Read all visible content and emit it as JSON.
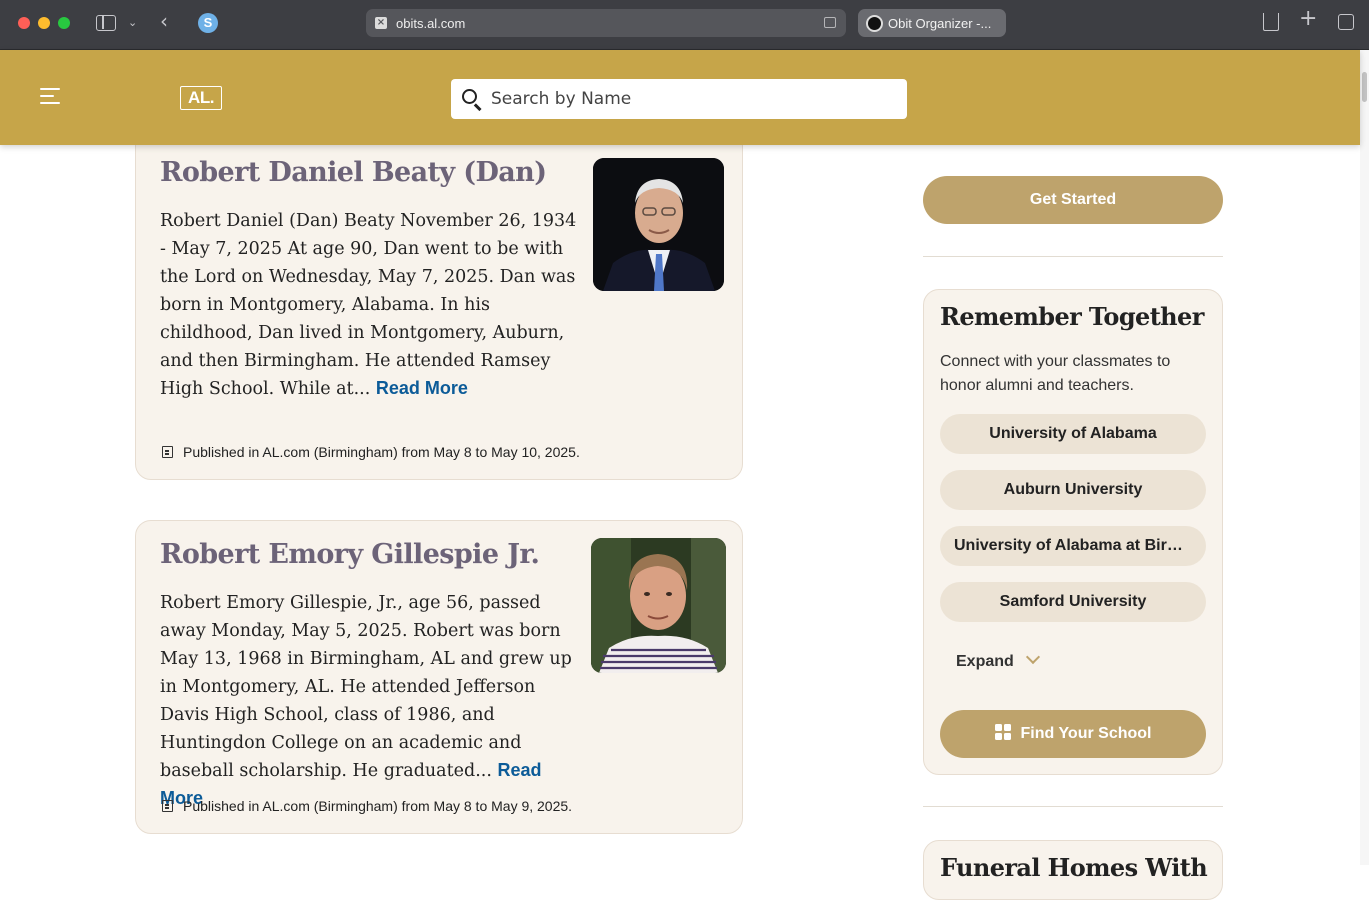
{
  "browser": {
    "url": "obits.al.com",
    "tab_title": "Obit Organizer -...",
    "extension_letter": "S"
  },
  "header": {
    "logo_text": "AL.",
    "search_placeholder": "Search by Name",
    "background_color": "#c6a549"
  },
  "obituaries": [
    {
      "name": "Robert Daniel Beaty (Dan)",
      "excerpt": "Robert Daniel (Dan) Beaty November 26, 1934 - May 7, 2025 At age 90, Dan went to be with the Lord on Wednesday, May 7, 2025. Dan was born in Montgomery, Alabama. In his childhood, Dan lived in Montgomery, Auburn, and then Birmingham. He attended Ramsey High School. While at...",
      "read_more": "Read More",
      "published": "Published in AL.com (Birmingham) from May 8 to May 10, 2025."
    },
    {
      "name": "Robert Emory Gillespie Jr.",
      "excerpt": "Robert Emory Gillespie, Jr., age 56, passed away Monday, May 5, 2025. Robert was born May 13, 1968 in Birmingham, AL and grew up in Montgomery, AL. He attended Jefferson Davis High School, class of 1986, and Huntingdon College on an academic and baseball scholarship. He graduated...",
      "read_more": "Read More",
      "published": "Published in AL.com (Birmingham) from May 8 to May 9, 2025."
    }
  ],
  "sidebar": {
    "get_started": "Get Started",
    "remember": {
      "title": "Remember Together",
      "description": "Connect with your classmates to honor alumni and teachers.",
      "schools": [
        "University of Alabama",
        "Auburn University",
        "University of Alabama at Birmingham",
        "Samford University"
      ],
      "expand": "Expand",
      "find_school": "Find Your School"
    },
    "funeral_homes_title": "Funeral Homes With"
  },
  "colors": {
    "accent_gold": "#bea36c",
    "link_blue": "#0c5b98",
    "card_bg": "#f8f3ec"
  }
}
